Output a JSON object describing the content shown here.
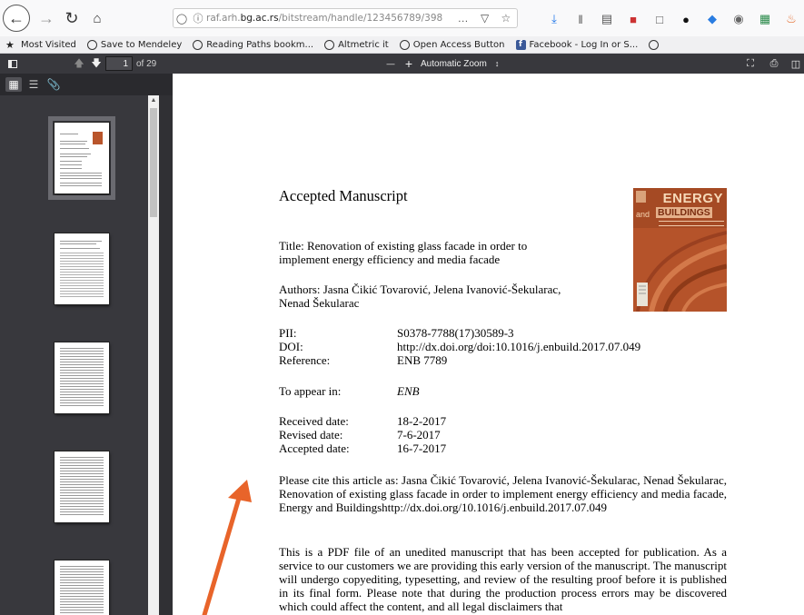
{
  "browser": {
    "url_host": "raf.arh.bg.ac.rs",
    "url_rest": "/bitstream/handle/123456789/398...",
    "url_prefix": "raf.arh.",
    "url_domain": "bg.ac.rs",
    "url_path": "/bitstream/handle/123456789/398",
    "url_action_dots": "…",
    "icons": [
      "back-arrow",
      "forward-arrow",
      "reload",
      "home",
      "shield",
      "info",
      "pocket",
      "bookmark-star",
      "download",
      "library",
      "reader",
      "pdf",
      "screenshot",
      "extension",
      "extension",
      "extension",
      "extension",
      "extension"
    ]
  },
  "bookmarks": [
    {
      "label": "Most Visited",
      "icon": "star"
    },
    {
      "label": "Save to Mendeley",
      "icon": "globe"
    },
    {
      "label": "Reading Paths bookm...",
      "icon": "globe"
    },
    {
      "label": "Altmetric it",
      "icon": "globe"
    },
    {
      "label": "Open Access Button",
      "icon": "globe"
    },
    {
      "label": "Facebook - Log In or S...",
      "icon": "facebook"
    },
    {
      "label": "",
      "icon": "globe"
    }
  ],
  "pdf_toolbar": {
    "page_number": "1",
    "page_count": "of 29",
    "zoom_minus": "—",
    "zoom_plus": "+",
    "zoom_value": "Automatic Zoom",
    "zoom_caret": "↕"
  },
  "document": {
    "heading": "Accepted Manuscript",
    "title_line1": "Title: Renovation of existing glass facade in order to",
    "title_line2": "implement energy efficiency and media facade",
    "authors_line1": "Authors: Jasna Čikić Tovarović, Jelena Ivanović-Šekularac,",
    "authors_line2": "Nenad Šekularac",
    "pii_label": "PII:",
    "pii_value": "S0378-7788(17)30589-3",
    "doi_label": "DOI:",
    "doi_value": "http://dx.doi.org/doi:10.1016/j.enbuild.2017.07.049",
    "ref_label": "Reference:",
    "ref_value": "ENB 7789",
    "appear_label": "To appear in:",
    "appear_value": "ENB",
    "received_label": "Received date:",
    "received_value": "18-2-2017",
    "revised_label": "Revised date:",
    "revised_value": "7-6-2017",
    "accepted_label": "Accepted date:",
    "accepted_value": "16-7-2017",
    "cite_para": "Please cite this article as: Jasna Čikić Tovarović, Jelena Ivanović-Šekularac, Nenad Šekularac, Renovation of existing glass facade in order to implement energy efficiency and media facade, Energy and Buildingshttp://dx.doi.org/10.1016/j.enbuild.2017.07.049",
    "notice_para": "This is a PDF file of an unedited manuscript that has been accepted for publication. As a service to our customers we are providing this early version of the manuscript. The manuscript will undergo copyediting, typesetting, and review of the resulting proof before it is published in its final form. Please note that during the production process errors may be discovered which could affect the content, and all legal disclaimers that"
  },
  "cover": {
    "word1": "ENERGY",
    "word2": "and",
    "word3": "BUILDINGS"
  },
  "annotation": {
    "color": "#e8642a"
  }
}
